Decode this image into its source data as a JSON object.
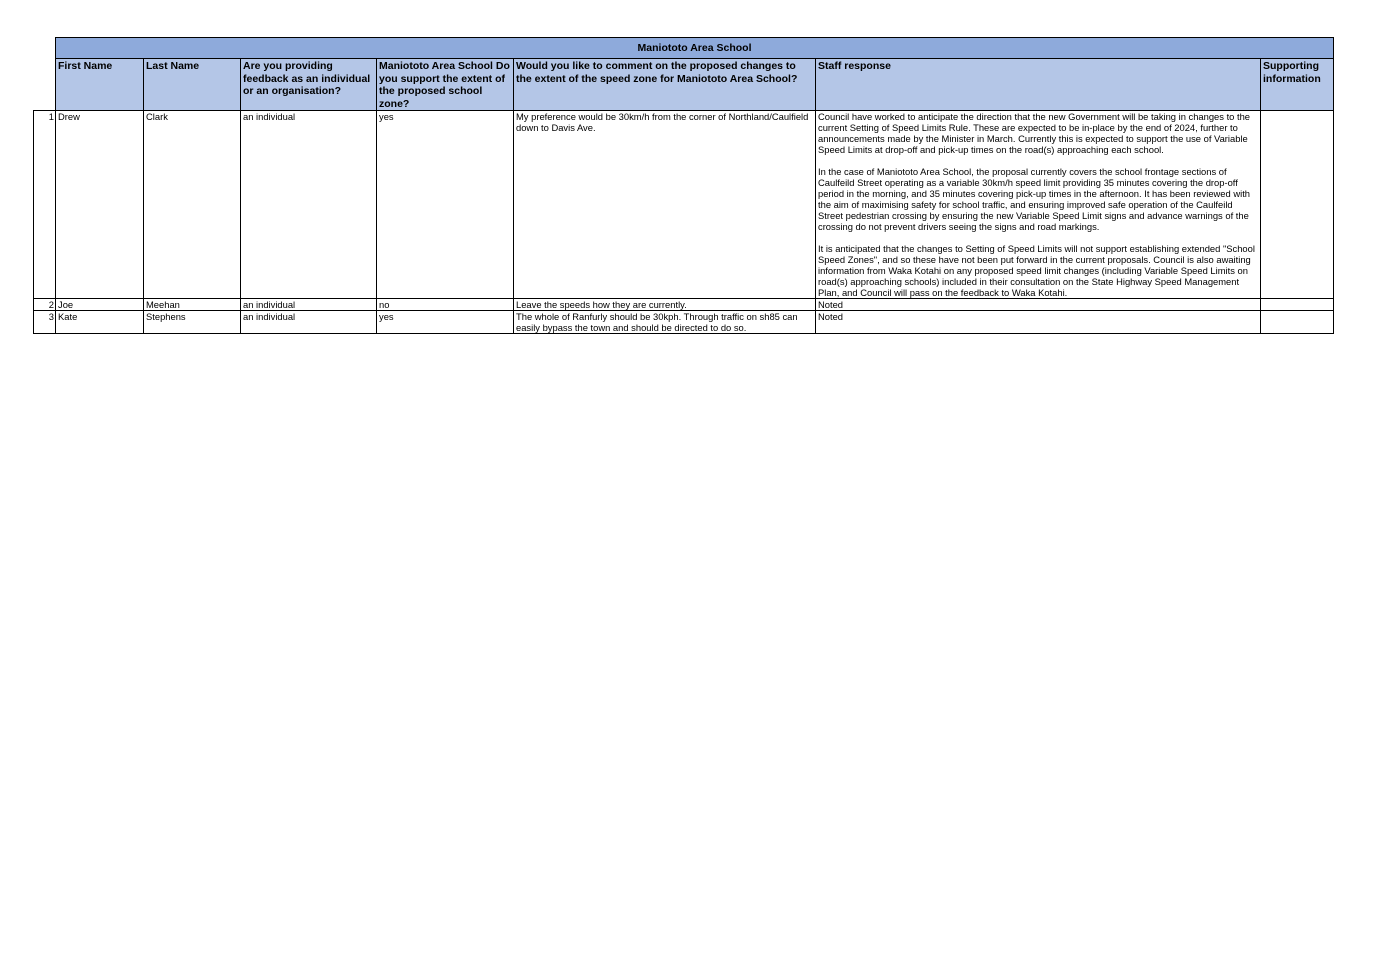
{
  "sheet": {
    "title": "Maniototo Area School",
    "headers": [
      "First Name",
      "Last Name",
      "Are you providing feedback as an individual or an organisation?",
      "Maniototo Area School Do you support the extent of the proposed school zone?",
      "Would you like to comment on the proposed changes to the extent of the speed zone for Maniototo Area School?",
      "Staff response",
      "Supporting information"
    ],
    "rows": [
      {
        "num": "1",
        "first": "Drew",
        "last": "Clark",
        "type": "an individual",
        "support": "yes",
        "comment": "My preference would be 30km/h from the corner of Northland/Caulfield down to Davis Ave.",
        "response": "Council have worked to anticipate the direction that the new Government will be taking in changes to the current Setting of Speed Limits Rule. These are expected to be in-place by the end of 2024, further to announcements made by the Minister in March. Currently this is expected to support the use of Variable Speed Limits at drop-off and pick-up times on the road(s) approaching each school.\n\nIn the case of Maniototo Area School, the proposal currently covers the school frontage sections of Caulfeild Street operating as a variable 30km/h speed limit providing 35 minutes covering the drop-off period in the morning, and 35 minutes covering pick-up times in the afternoon. It has been reviewed with the aim of maximising safety for school traffic, and ensuring improved safe operation of the Caulfeild Street pedestrian crossing by ensuring the new Variable Speed Limit signs and advance warnings of the crossing do not prevent drivers seeing the signs and road markings.\n\nIt is anticipated that the changes to Setting of Speed Limits will not support establishing extended \"School Speed Zones\", and so these have not been put forward in the current proposals. Council is also awaiting information from Waka Kotahi on any proposed speed limit changes (including Variable Speed Limits on road(s) approaching schools) included in their consultation on the State Highway Speed Management Plan, and Council will pass on the feedback to Waka Kotahi.",
        "supporting": ""
      },
      {
        "num": "2",
        "first": "Joe",
        "last": "Meehan",
        "type": "an individual",
        "support": "no",
        "comment": "Leave the speeds how they are currently.",
        "response": "Noted",
        "supporting": ""
      },
      {
        "num": "3",
        "first": "Kate",
        "last": "Stephens",
        "type": "an individual",
        "support": "yes",
        "comment": "The whole of Ranfurly should be 30kph. Through traffic on sh85 can easily bypass the town and should be directed to do so.",
        "response": "Noted",
        "supporting": ""
      }
    ]
  }
}
